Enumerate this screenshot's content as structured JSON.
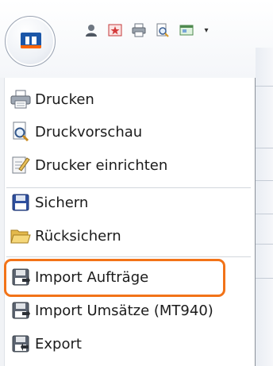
{
  "menu": {
    "items": [
      {
        "label": "Drucken",
        "icon": "printer-icon"
      },
      {
        "label": "Druckvorschau",
        "icon": "print-preview-icon"
      },
      {
        "label": "Drucker einrichten",
        "icon": "printer-setup-icon"
      },
      {
        "label": "Sichern",
        "icon": "save-disk-icon"
      },
      {
        "label": "Rücksichern",
        "icon": "open-folder-icon"
      },
      {
        "label": "Import Aufträge",
        "icon": "import-disk-icon"
      },
      {
        "label": "Import Umsätze (MT940)",
        "icon": "import-disk-icon"
      },
      {
        "label": "Export",
        "icon": "export-disk-icon"
      }
    ]
  },
  "quick_access_toolbar": {
    "icons": [
      "user-icon",
      "star-icon",
      "printer-icon",
      "print-preview-icon",
      "window-icon",
      "dropdown-arrow-icon"
    ]
  },
  "app_button": {
    "icon": "bank-logo-icon"
  },
  "colors": {
    "highlight": "#f27318",
    "logo_blue": "#1c57a8",
    "logo_orange": "#ff6600"
  }
}
